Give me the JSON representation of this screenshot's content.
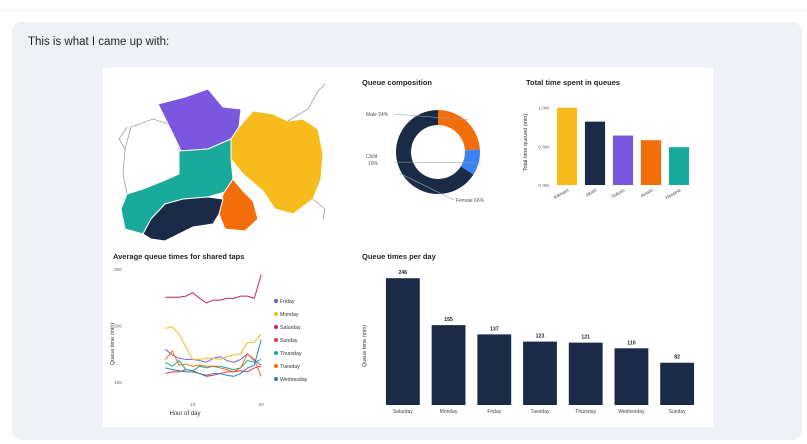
{
  "message": {
    "text": "This is what I came up with:"
  },
  "map": {
    "region_colors": [
      "#7b57e0",
      "#f7bb1e",
      "#1aaa9b",
      "#1b2b47",
      "#f46d0b",
      "#ffffff"
    ]
  },
  "chart_data": [
    {
      "type": "pie",
      "title": "Queue composition",
      "categories": [
        "Male 24%",
        "Child 10%",
        "Female 66%"
      ],
      "values": [
        24,
        10,
        66
      ],
      "colors": [
        "#f46d0b",
        "#3b82f6",
        "#1b2b47"
      ]
    },
    {
      "type": "bar",
      "title": "Total time spent in queues",
      "ylabel": "Total time queued (min)",
      "categories": [
        "Kilimani",
        "Akoth",
        "Sokoto",
        "Amani",
        "Hassina"
      ],
      "values": [
        1.0,
        0.82,
        0.64,
        0.58,
        0.49
      ],
      "colors": [
        "#f7bb1e",
        "#1b2b47",
        "#7b57e0",
        "#f46d0b",
        "#1aaa9b"
      ],
      "ylim": [
        0,
        1.1
      ],
      "yticks": [
        {
          "value": 0,
          "label": "0.0M"
        },
        {
          "value": 0.5,
          "label": "0.5M"
        },
        {
          "value": 1.0,
          "label": "1.0M"
        }
      ]
    },
    {
      "type": "line",
      "title": "Average queue times for shared taps",
      "xlabel": "Hour of day",
      "ylabel": "Queue time (min)",
      "xlim": [
        2,
        21
      ],
      "ylim": [
        70,
        300
      ],
      "xticks": [
        10,
        20
      ],
      "yticks": [
        100,
        200,
        300
      ],
      "series": [
        {
          "name": "Friday",
          "color": "#7b57e0",
          "x": [
            6,
            7,
            8,
            9,
            10,
            11,
            12,
            13,
            14,
            15,
            16,
            17,
            18,
            19,
            20
          ],
          "y": [
            158,
            148,
            142,
            140,
            140,
            138,
            135,
            142,
            145,
            138,
            135,
            140,
            150,
            138,
            130
          ]
        },
        {
          "name": "Monday",
          "color": "#f7bb1e",
          "x": [
            6,
            7,
            8,
            9,
            10,
            11,
            12,
            13,
            14,
            15,
            16,
            17,
            18,
            19,
            20
          ],
          "y": [
            195,
            198,
            185,
            162,
            140,
            140,
            142,
            142,
            140,
            145,
            148,
            150,
            170,
            170,
            185
          ]
        },
        {
          "name": "Saturday",
          "color": "#c2245c",
          "x": [
            6,
            7,
            8,
            9,
            10,
            11,
            12,
            13,
            14,
            15,
            16,
            17,
            18,
            19,
            20
          ],
          "y": [
            250,
            250,
            250,
            252,
            258,
            248,
            240,
            245,
            245,
            248,
            248,
            252,
            252,
            248,
            290
          ]
        },
        {
          "name": "Sunday",
          "color": "#e8384f",
          "x": [
            6,
            7,
            8,
            9,
            10,
            11,
            12,
            13,
            14,
            15,
            16,
            17,
            18,
            19,
            20
          ],
          "y": [
            115,
            118,
            118,
            122,
            120,
            115,
            110,
            112,
            115,
            118,
            118,
            120,
            118,
            125,
            128
          ]
        },
        {
          "name": "Thursday",
          "color": "#1aaa9b",
          "x": [
            6,
            7,
            8,
            9,
            10,
            11,
            12,
            13,
            14,
            15,
            16,
            17,
            18,
            19,
            20
          ],
          "y": [
            135,
            128,
            138,
            122,
            120,
            128,
            125,
            128,
            128,
            125,
            122,
            125,
            138,
            135,
            140
          ]
        },
        {
          "name": "Tuesday",
          "color": "#f46d0b",
          "x": [
            6,
            7,
            8,
            9,
            10,
            11,
            12,
            13,
            14,
            15,
            16,
            17,
            18,
            19,
            20
          ],
          "y": [
            140,
            155,
            130,
            132,
            128,
            130,
            128,
            128,
            125,
            122,
            118,
            125,
            150,
            140,
            110
          ]
        },
        {
          "name": "Wednesday",
          "color": "#2d7fc1",
          "x": [
            6,
            7,
            8,
            9,
            10,
            11,
            12,
            13,
            14,
            15,
            16,
            17,
            18,
            19,
            20
          ],
          "y": [
            125,
            122,
            120,
            118,
            118,
            115,
            112,
            115,
            115,
            112,
            110,
            115,
            125,
            130,
            175
          ]
        }
      ]
    },
    {
      "type": "bar",
      "title": "Queue times per day",
      "ylabel": "Queue time (min)",
      "categories": [
        "Saturday",
        "Monday",
        "Friday",
        "Tuesday",
        "Thursday",
        "Wednesday",
        "Sunday"
      ],
      "values": [
        246,
        155,
        137,
        123,
        121,
        110,
        82
      ],
      "labels": [
        "246",
        "155",
        "137",
        "123",
        "121",
        "110",
        "82"
      ],
      "color": "#1b2b47",
      "ylim": [
        0,
        260
      ]
    }
  ]
}
